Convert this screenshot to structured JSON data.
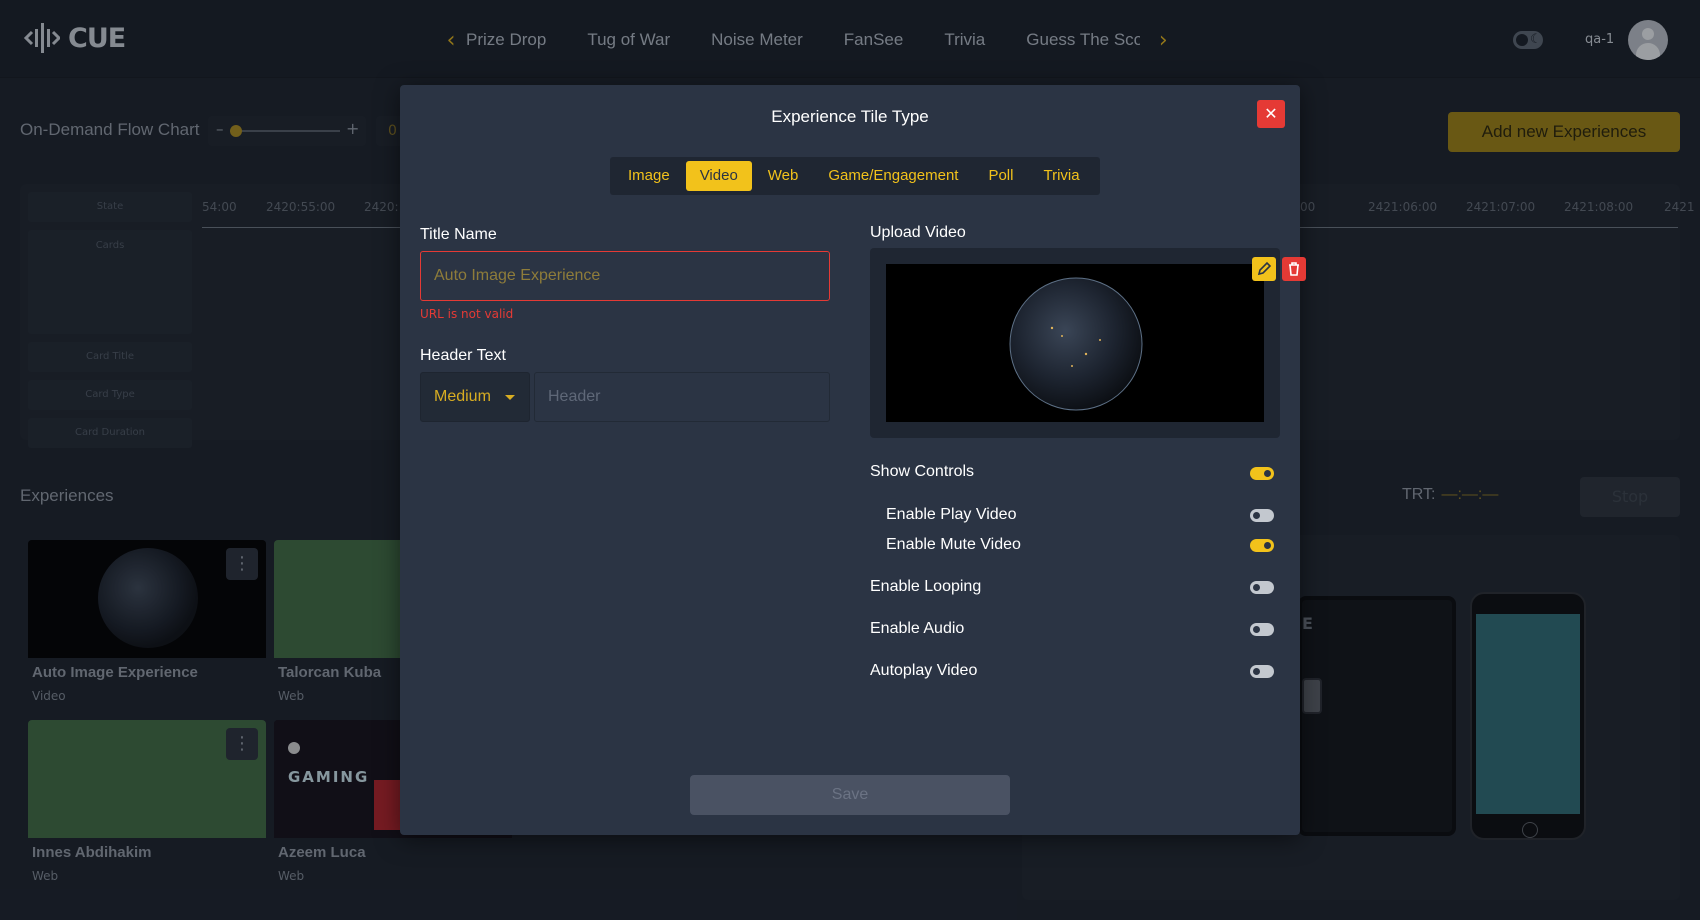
{
  "app": {
    "logo_text": "CUE",
    "user": "qa-1"
  },
  "nav": {
    "tabs": [
      "Prize Drop",
      "Tug of War",
      "Noise Meter",
      "FanSee",
      "Trivia",
      "Guess The Sco"
    ],
    "prev_icon": "chevron-left-icon",
    "next_icon": "chevron-right-icon"
  },
  "flow": {
    "title": "On-Demand Flow Chart",
    "zoom_value": "0",
    "add_button": "Add new Experiences",
    "row_labels": [
      "State",
      "Cards",
      "Card Title",
      "Card Type",
      "Card Duration"
    ],
    "ticks_left": [
      "54:00",
      "2420:55:00",
      "2420:"
    ],
    "ticks_right": [
      "00",
      "2421:06:00",
      "2421:07:00",
      "2421:08:00",
      "2421"
    ]
  },
  "experiences": {
    "title": "Experiences",
    "trt_label": "TRT:",
    "trt_value": "—:—:—",
    "stop_button": "Stop",
    "cards": [
      {
        "name": "Auto Image Experience",
        "type": "Video"
      },
      {
        "name": "Talorcan Kuba",
        "type": "Web"
      },
      {
        "name": "Innes Abdihakim",
        "type": "Web"
      },
      {
        "name": "Azeem Luca",
        "type": "Web"
      }
    ],
    "tablet_letter": "E"
  },
  "modal": {
    "title": "Experience Tile Type",
    "tile_types": [
      "Image",
      "Video",
      "Web",
      "Game/Engagement",
      "Poll",
      "Trivia"
    ],
    "active_type": "Video",
    "title_name_label": "Title Name",
    "title_name_value": "Auto Image Experience",
    "title_error": "URL is not valid",
    "header_text_label": "Header Text",
    "header_size": "Medium",
    "header_placeholder": "Header",
    "upload_label": "Upload Video",
    "toggles": [
      {
        "label": "Show Controls",
        "on": true
      },
      {
        "label": "Enable Play Video",
        "on": false
      },
      {
        "label": "Enable Mute Video",
        "on": true
      },
      {
        "label": "Enable Looping",
        "on": false
      },
      {
        "label": "Enable Audio",
        "on": false
      },
      {
        "label": "Autoplay Video",
        "on": false
      }
    ],
    "save_button": "Save"
  },
  "colors": {
    "accent": "#f2c21b",
    "danger": "#e53a35",
    "modal_bg": "#2b3444"
  }
}
